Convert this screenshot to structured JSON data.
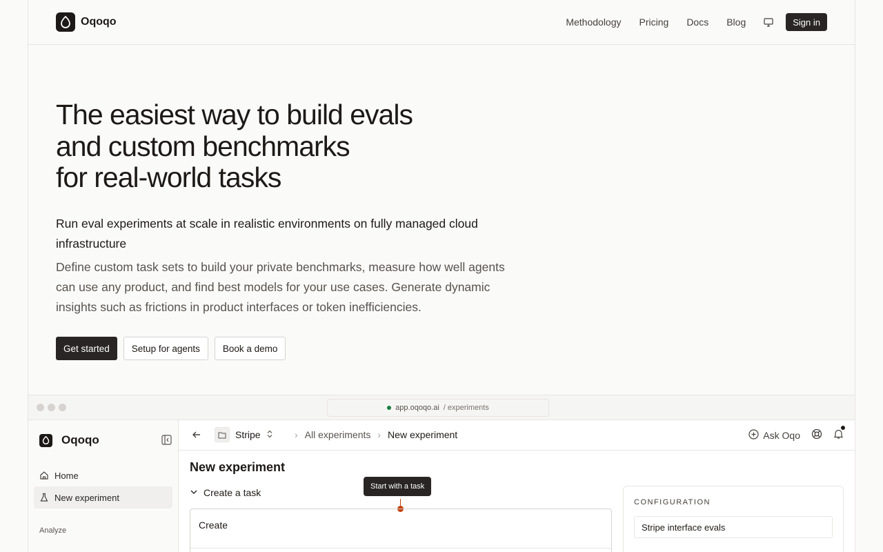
{
  "nav": {
    "brand": "Oqoqo",
    "links": [
      "Methodology",
      "Pricing",
      "Docs",
      "Blog"
    ],
    "sign_in": "Sign in"
  },
  "hero": {
    "title_lines": [
      "The easiest way to build evals",
      "and custom benchmarks",
      "for real-world tasks"
    ],
    "lead": "Run eval experiments at scale in realistic environments on fully managed cloud infrastructure",
    "description": "Define custom task sets to build your private benchmarks, measure how well agents can use any product, and find best models for your use cases. Generate dynamic insights such as frictions in product interfaces or token inefficiencies.",
    "buttons": {
      "get_started": "Get started",
      "setup_agents": "Setup for agents",
      "book_demo": "Book a demo"
    }
  },
  "preview": {
    "url_host": "app.oqoqo.ai",
    "url_path": "/ experiments",
    "sidebar": {
      "brand": "Oqoqo",
      "items": [
        {
          "label": "Home",
          "icon": "home-icon"
        },
        {
          "label": "New experiment",
          "icon": "flask-icon",
          "active": true
        }
      ],
      "section": "Analyze"
    },
    "header": {
      "project": "Stripe",
      "crumbs": [
        "All experiments",
        "New experiment"
      ],
      "ask": "Ask Oqo"
    },
    "main": {
      "title": "New experiment",
      "toggle": "Create a task",
      "tooltip": "Start with a task",
      "create_label": "Create"
    },
    "config": {
      "heading": "CONFIGURATION",
      "name_value": "Stripe interface evals"
    }
  },
  "colors": {
    "accent_dark": "#292524",
    "marker": "#c2410c",
    "status_green": "#15803d"
  }
}
